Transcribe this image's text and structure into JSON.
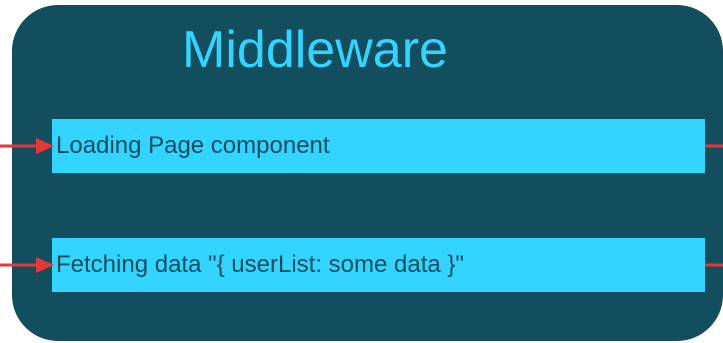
{
  "diagram": {
    "title": "Middleware",
    "steps": [
      {
        "label": "Loading Page component"
      },
      {
        "label": "Fetching data \"{ userList: some data }\""
      }
    ],
    "colors": {
      "panel": "#134e5e",
      "box": "#33d4ff",
      "text": "#134e5e",
      "title": "#33d4ff",
      "arrow": "#e8373a"
    }
  }
}
